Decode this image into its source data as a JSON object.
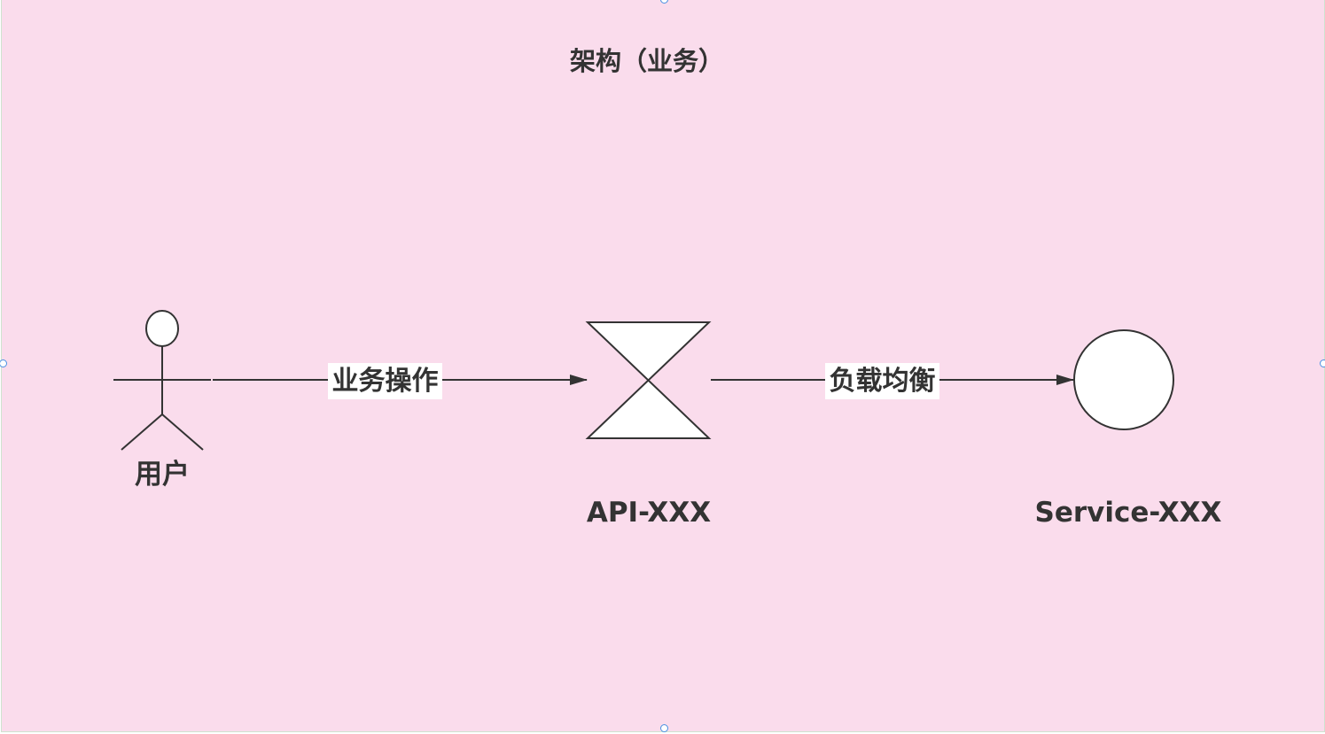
{
  "diagram": {
    "title": "架构（业务）",
    "background_color": "#fadcec",
    "stroke_color": "#333333",
    "label_background": "#ffffff",
    "nodes": [
      {
        "id": "user",
        "shape": "actor",
        "label": "用户"
      },
      {
        "id": "api",
        "shape": "hourglass",
        "label": "API-XXX"
      },
      {
        "id": "service",
        "shape": "circle",
        "label": "Service-XXX"
      }
    ],
    "edges": [
      {
        "from": "user",
        "to": "api",
        "label": "业务操作"
      },
      {
        "from": "api",
        "to": "service",
        "label": "负载均衡"
      }
    ]
  }
}
